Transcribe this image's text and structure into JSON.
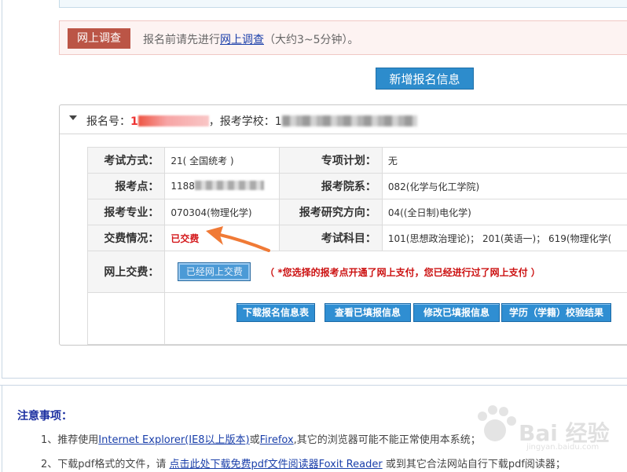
{
  "survey": {
    "badge": "网上调查",
    "text_before": "报名前请先进行",
    "link": "网上调查",
    "text_after": "（大约3~5分钟）。"
  },
  "add_button": "新增报名信息",
  "panel": {
    "reg_label": "报名号：",
    "reg_value_visible": "1",
    "school_label": "，报考学校：",
    "school_value_visible": "1"
  },
  "table": {
    "exam_mode_label": "考试方式：",
    "exam_mode_value": "21( 全国统考 )",
    "special_plan_label": "专项计划：",
    "special_plan_value": "无",
    "site_label": "报考点：",
    "site_value_visible": "1188",
    "dept_label": "报考院系：",
    "dept_value": "082(化学与化工学院)",
    "major_label": "报考专业：",
    "major_value": "070304(物理化学)",
    "direction_label": "报考研究方向：",
    "direction_value": "04((全日制)电化学)",
    "payment_label": "交费情况：",
    "payment_value": "已交费",
    "subjects_label": "考试科目：",
    "subjects_value": "101(思想政治理论)； 201(英语一)； 619(物理化学(",
    "online_pay_label": "网上交费：",
    "online_pay_button": "已经网上交费",
    "online_pay_note": "（ *您选择的报考点开通了网上支付，您已经进行过了网上支付 ）"
  },
  "actions": [
    "下载报名信息表",
    "查看已填报信息",
    "修改已填报信息",
    "学历（学籍）校验结果"
  ],
  "notes": {
    "title": "注意事项：",
    "line1": {
      "prefix": "1、推荐使用",
      "link1": "Internet Explorer(IE8以上版本)",
      "mid": "或",
      "link2": "Firefox",
      "suffix": ",其它的浏览器可能不能正常使用本系统；"
    },
    "line2": {
      "prefix": "2、下载pdf格式的文件，请 ",
      "link": "点击此处下载免费pdf文件阅读器Foxit Reader",
      "suffix": " 或到其它合法网站自行下载pdf阅读器；"
    }
  },
  "watermark": {
    "text": "Bai 经验",
    "sub": "jingyan.baidu.com"
  },
  "colors": {
    "accent_blue": "#2d8ccc",
    "badge_red": "#bb5546",
    "paid_red": "#d4181b",
    "arrow": "#f07a36"
  }
}
